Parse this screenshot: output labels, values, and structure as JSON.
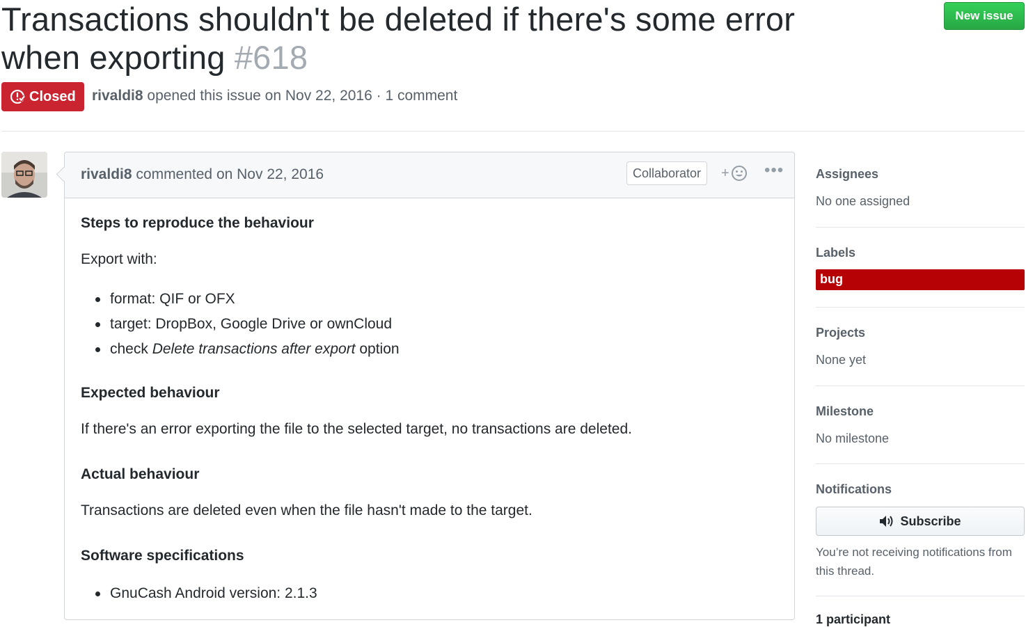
{
  "issue": {
    "title": "Transactions shouldn't be deleted if there's some error when exporting",
    "number": "#618",
    "state": "Closed",
    "author": "rivaldi8",
    "opened_text": "opened this issue on Nov 22, 2016 · 1 comment"
  },
  "header": {
    "new_issue_label": "New issue"
  },
  "comment": {
    "author": "rivaldi8",
    "commented_text": "commented on Nov 22, 2016",
    "role_badge": "Collaborator",
    "steps_heading": "Steps to reproduce the behaviour",
    "export_with": "Export with:",
    "steps": [
      {
        "text": "format: QIF or OFX"
      },
      {
        "text": "target: DropBox, Google Drive or ownCloud"
      },
      {
        "prefix": "check ",
        "emphasis": "Delete transactions after export",
        "suffix": " option"
      }
    ],
    "expected_heading": "Expected behaviour",
    "expected_text": "If there's an error exporting the file to the selected target, no transactions are deleted.",
    "actual_heading": "Actual behaviour",
    "actual_text": "Transactions are deleted even when the file hasn't made to the target.",
    "software_heading": "Software specifications",
    "software_items": [
      "GnuCash Android version: 2.1.3"
    ]
  },
  "sidebar": {
    "assignees_heading": "Assignees",
    "assignees_value": "No one assigned",
    "labels_heading": "Labels",
    "label_bug": "bug",
    "label_bug_color": "#b60205",
    "projects_heading": "Projects",
    "projects_value": "None yet",
    "milestone_heading": "Milestone",
    "milestone_value": "No milestone",
    "notifications_heading": "Notifications",
    "subscribe_label": "Subscribe",
    "notifications_note": "You’re not receiving notifications from this thread.",
    "participants": "1 participant"
  },
  "colors": {
    "closed": "#cb2431",
    "new_issue": "#28a745"
  }
}
